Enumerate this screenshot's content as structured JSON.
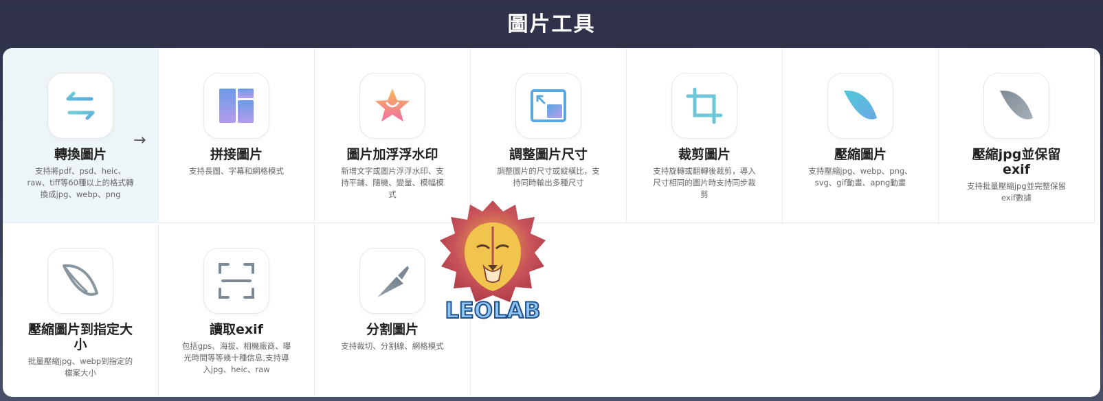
{
  "page": {
    "title": "圖片工具"
  },
  "tools": [
    {
      "title": "轉換圖片",
      "desc": "支持將pdf、psd、heic、raw、tiff等60種以上的格式轉換成jpg、webp、png",
      "icon": "convert-arrows-icon"
    },
    {
      "title": "拼接圖片",
      "desc": "支持長圖、字幕和網格模式",
      "icon": "collage-layout-icon"
    },
    {
      "title": "圖片加浮浮水印",
      "desc": "新增文字或圖片浮浮水印、支持平鋪、隨機、變量、模幅模式",
      "icon": "star-watermark-icon"
    },
    {
      "title": "調整圖片尺寸",
      "desc": "調整圖片的尺寸或縱橫比，支持同時輸出多種尺寸",
      "icon": "resize-icon"
    },
    {
      "title": "裁剪圖片",
      "desc": "支持旋轉或翻轉後裁剪，導入尺寸相同的圖片時支持同步裁剪",
      "icon": "crop-icon"
    },
    {
      "title": "壓縮圖片",
      "desc": "支持壓縮jpg、webp、png、svg、gif動畫、apng動畫",
      "icon": "feather-compress-icon"
    },
    {
      "title": "壓縮jpg並保留exif",
      "desc": "支持批量壓縮jpg並完整保留exif數據",
      "icon": "feather-exif-icon"
    },
    {
      "title": "壓縮圖片到指定大小",
      "desc": "批量壓縮jpg、webp到指定的檔案大小",
      "icon": "feather-outline-icon"
    },
    {
      "title": "讀取exif",
      "desc": "包括gps、海拔、相機廠商、曝光時間等等幾十種信息,支持導入jpg、heic、raw",
      "icon": "scan-frame-icon"
    },
    {
      "title": "分割圖片",
      "desc": "支持裁切、分割線、網格模式",
      "icon": "knife-icon"
    }
  ],
  "watermark": {
    "text": "LEOLAB"
  },
  "colors": {
    "accent": "#5bc0de",
    "active_bg": "#eef5f9"
  }
}
